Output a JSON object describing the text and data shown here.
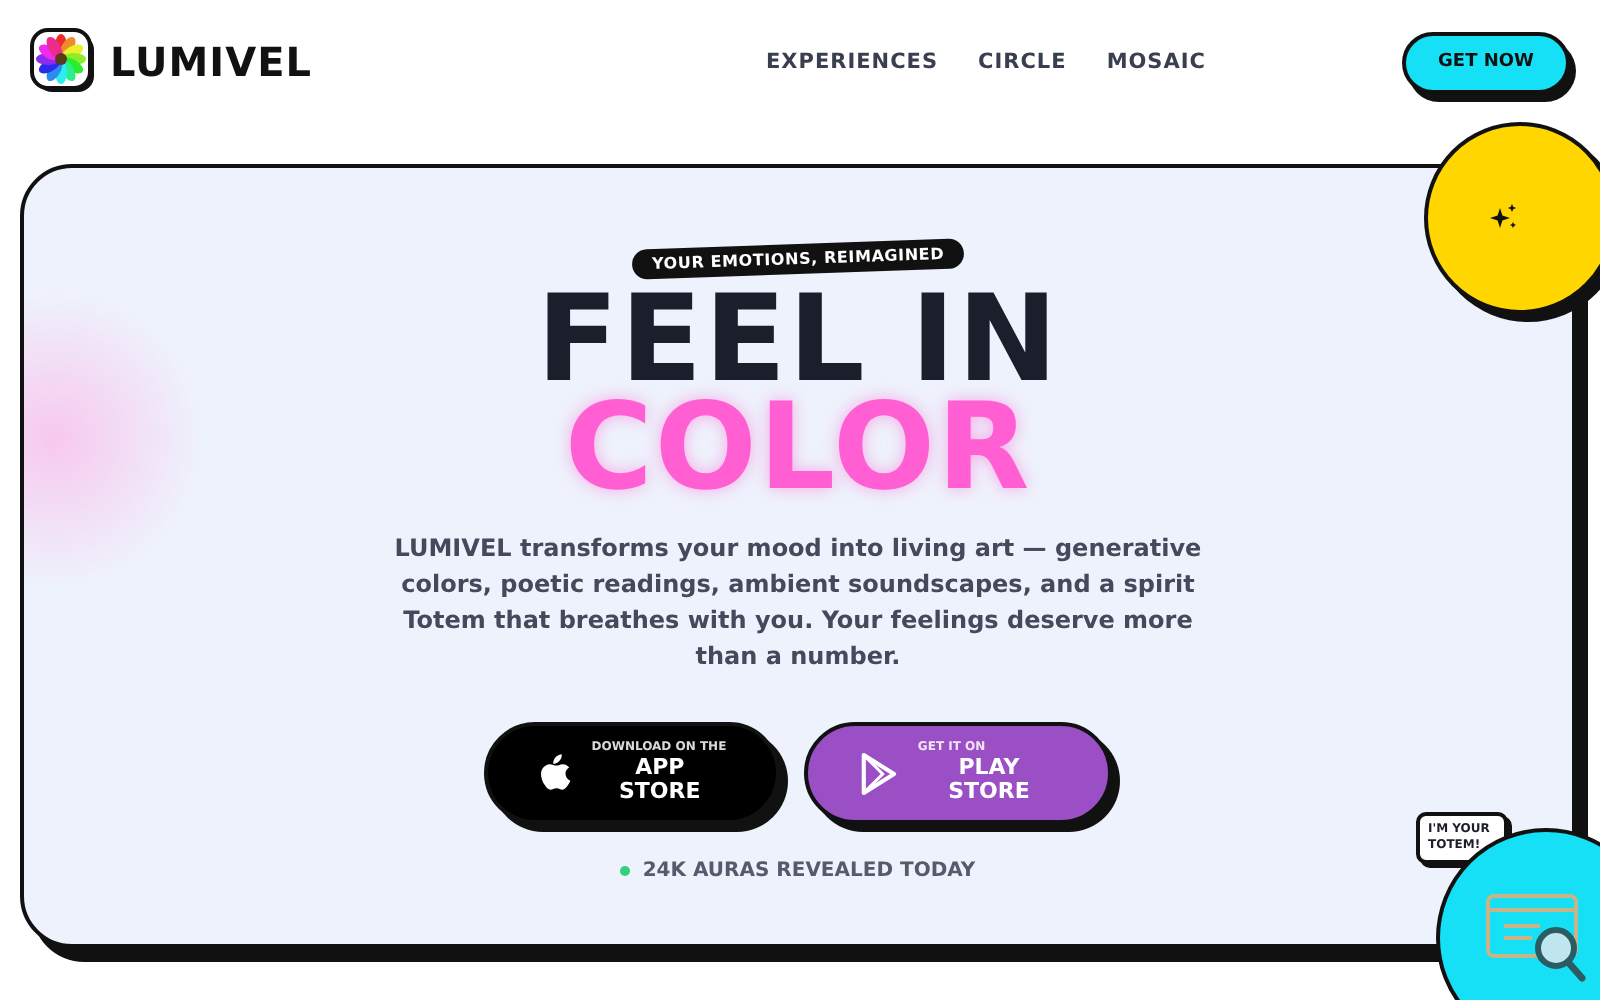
{
  "brand": {
    "name": "LUMIVEL"
  },
  "nav": [
    {
      "label": "EXPERIENCES"
    },
    {
      "label": "CIRCLE"
    },
    {
      "label": "MOSAIC"
    }
  ],
  "cta": {
    "label": "GET NOW"
  },
  "hero": {
    "badge": "YOUR EMOTIONS, REIMAGINED",
    "title_line_1": "FEEL IN",
    "title_line_2": "COLOR",
    "description": "LUMIVEL transforms your mood into living art — generative colors, poetic readings, ambient soundscapes, and a spirit Totem that breathes with you. Your feelings deserve more than a number.",
    "store_buttons": [
      {
        "kind": "apple",
        "small": "DOWNLOAD ON THE",
        "big": "APP STORE"
      },
      {
        "kind": "play",
        "small": "GET IT ON",
        "big": "PLAY STORE"
      }
    ],
    "stat": "24K AURAS REVEALED TODAY"
  },
  "totem": {
    "bubble": "I'M YOUR TOTEM!"
  }
}
